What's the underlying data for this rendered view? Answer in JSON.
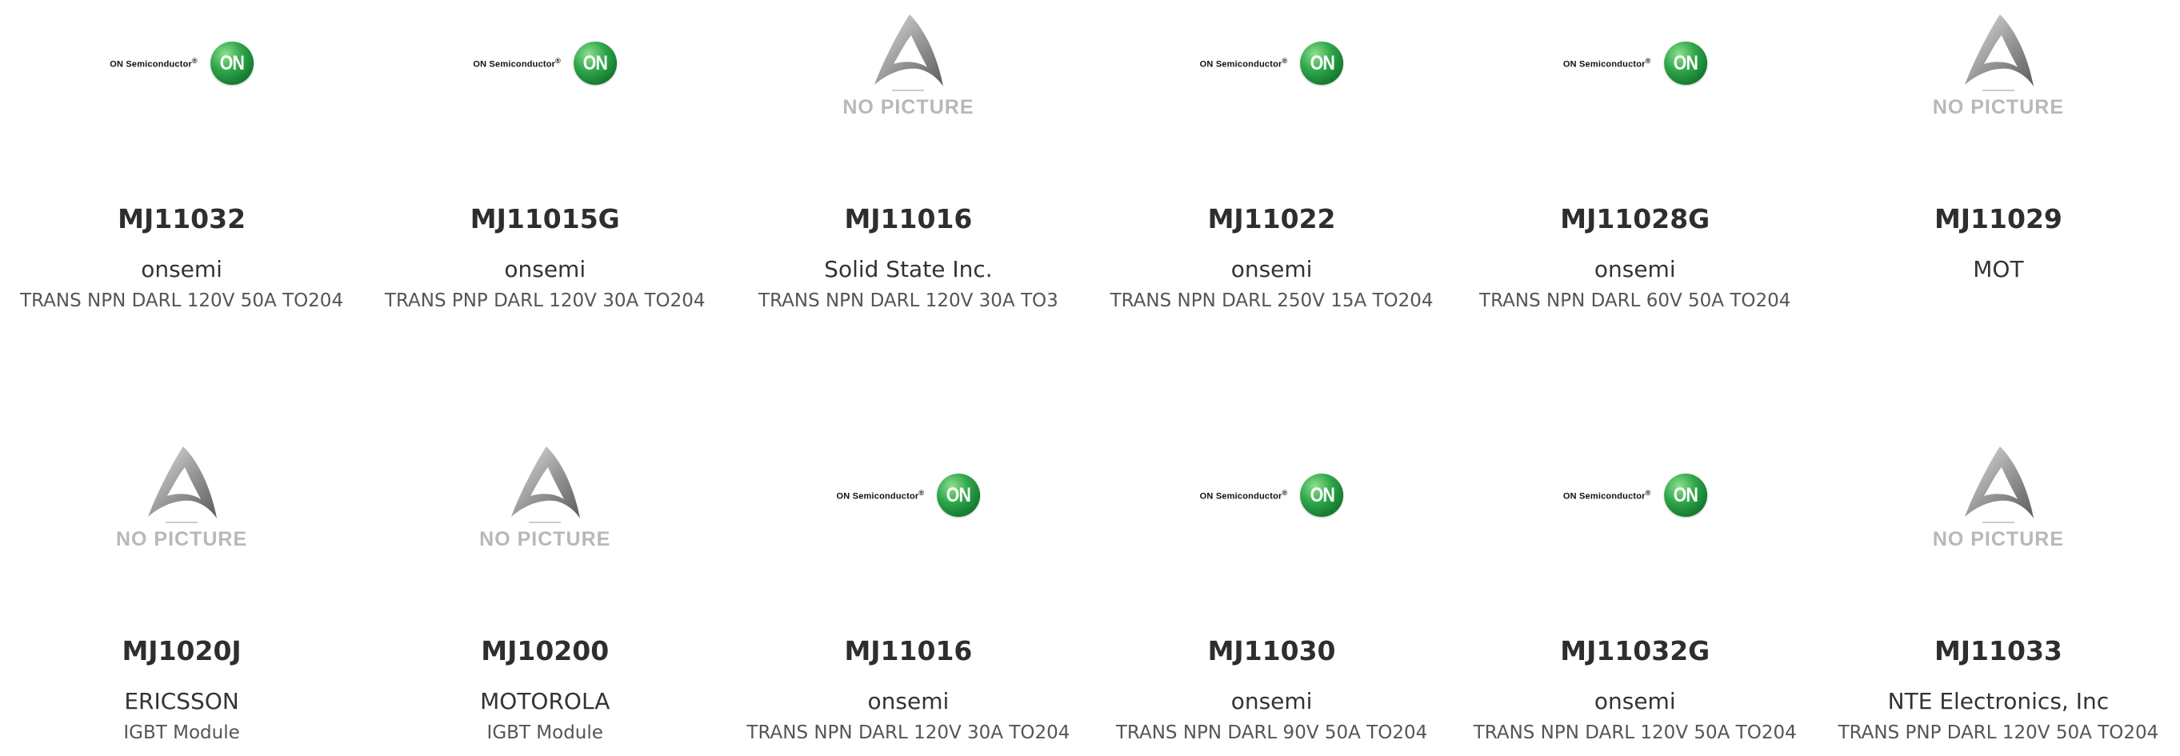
{
  "logos": {
    "on_semi_text": "ON Semiconductor",
    "on_semi_mark": "®",
    "on_badge": "ON",
    "no_picture": "NO PICTURE"
  },
  "colors": {
    "on_green": "#1f8f3a",
    "placeholder_gray": "#b8b8b8",
    "text_dark": "#2e2e2e"
  },
  "products": [
    {
      "image": "on-semi-logo",
      "part": "MJ11032",
      "manufacturer": "onsemi",
      "description": "TRANS NPN DARL 120V 50A TO204"
    },
    {
      "image": "on-semi-logo",
      "part": "MJ11015G",
      "manufacturer": "onsemi",
      "description": "TRANS PNP DARL 120V 30A TO204"
    },
    {
      "image": "no-picture",
      "part": "MJ11016",
      "manufacturer": "Solid State Inc.",
      "description": "TRANS NPN DARL 120V 30A TO3"
    },
    {
      "image": "on-semi-logo",
      "part": "MJ11022",
      "manufacturer": "onsemi",
      "description": "TRANS NPN DARL 250V 15A TO204"
    },
    {
      "image": "on-semi-logo",
      "part": "MJ11028G",
      "manufacturer": "onsemi",
      "description": "TRANS NPN DARL 60V 50A TO204"
    },
    {
      "image": "no-picture",
      "part": "MJ11029",
      "manufacturer": "MOT",
      "description": ""
    },
    {
      "image": "no-picture",
      "part": "MJ1020J",
      "manufacturer": "ERICSSON",
      "description": "IGBT Module"
    },
    {
      "image": "no-picture",
      "part": "MJ10200",
      "manufacturer": "MOTOROLA",
      "description": "IGBT Module"
    },
    {
      "image": "on-semi-logo",
      "part": "MJ11016",
      "manufacturer": "onsemi",
      "description": "TRANS NPN DARL 120V 30A TO204"
    },
    {
      "image": "on-semi-logo",
      "part": "MJ11030",
      "manufacturer": "onsemi",
      "description": "TRANS NPN DARL 90V 50A TO204"
    },
    {
      "image": "on-semi-logo",
      "part": "MJ11032G",
      "manufacturer": "onsemi",
      "description": "TRANS NPN DARL 120V 50A TO204"
    },
    {
      "image": "no-picture",
      "part": "MJ11033",
      "manufacturer": "NTE Electronics, Inc",
      "description": "TRANS PNP DARL 120V 50A TO204"
    }
  ]
}
